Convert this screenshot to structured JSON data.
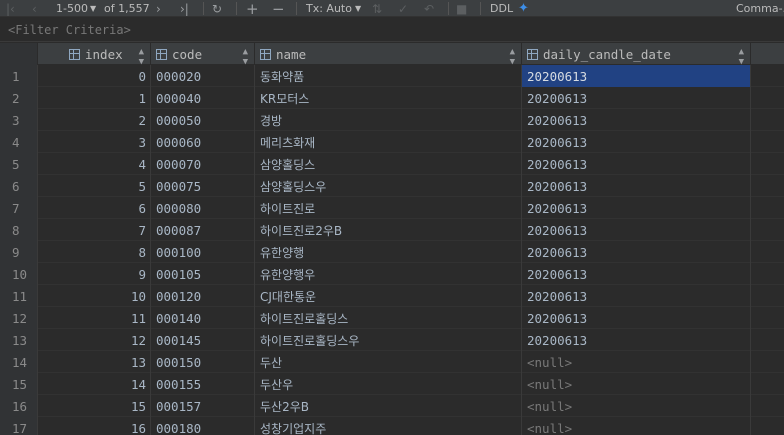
{
  "toolbar": {
    "range": "1-500",
    "of_label": "of 1,557",
    "tx_label": "Tx: Auto",
    "ddl_label": "DDL",
    "right_label": "Comma-..."
  },
  "filter": {
    "placeholder": "<Filter Criteria>"
  },
  "columns": [
    {
      "label": "index"
    },
    {
      "label": "code"
    },
    {
      "label": "name"
    },
    {
      "label": "daily_candle_date"
    }
  ],
  "rows": [
    {
      "n": "1",
      "index": "0",
      "code": "000020",
      "name": "동화약품",
      "date": "20200613"
    },
    {
      "n": "2",
      "index": "1",
      "code": "000040",
      "name": "KR모터스",
      "date": "20200613"
    },
    {
      "n": "3",
      "index": "2",
      "code": "000050",
      "name": "경방",
      "date": "20200613"
    },
    {
      "n": "4",
      "index": "3",
      "code": "000060",
      "name": "메리츠화재",
      "date": "20200613"
    },
    {
      "n": "5",
      "index": "4",
      "code": "000070",
      "name": "삼양홀딩스",
      "date": "20200613"
    },
    {
      "n": "6",
      "index": "5",
      "code": "000075",
      "name": "삼양홀딩스우",
      "date": "20200613"
    },
    {
      "n": "7",
      "index": "6",
      "code": "000080",
      "name": "하이트진로",
      "date": "20200613"
    },
    {
      "n": "8",
      "index": "7",
      "code": "000087",
      "name": "하이트진로2우B",
      "date": "20200613"
    },
    {
      "n": "9",
      "index": "8",
      "code": "000100",
      "name": "유한양행",
      "date": "20200613"
    },
    {
      "n": "10",
      "index": "9",
      "code": "000105",
      "name": "유한양행우",
      "date": "20200613"
    },
    {
      "n": "11",
      "index": "10",
      "code": "000120",
      "name": "CJ대한통운",
      "date": "20200613"
    },
    {
      "n": "12",
      "index": "11",
      "code": "000140",
      "name": "하이트진로홀딩스",
      "date": "20200613"
    },
    {
      "n": "13",
      "index": "12",
      "code": "000145",
      "name": "하이트진로홀딩스우",
      "date": "20200613"
    },
    {
      "n": "14",
      "index": "13",
      "code": "000150",
      "name": "두산",
      "date": "<null>"
    },
    {
      "n": "15",
      "index": "14",
      "code": "000155",
      "name": "두산우",
      "date": "<null>"
    },
    {
      "n": "16",
      "index": "15",
      "code": "000157",
      "name": "두산2우B",
      "date": "<null>"
    },
    {
      "n": "17",
      "index": "16",
      "code": "000180",
      "name": "성창기업지주",
      "date": "<null>"
    }
  ]
}
